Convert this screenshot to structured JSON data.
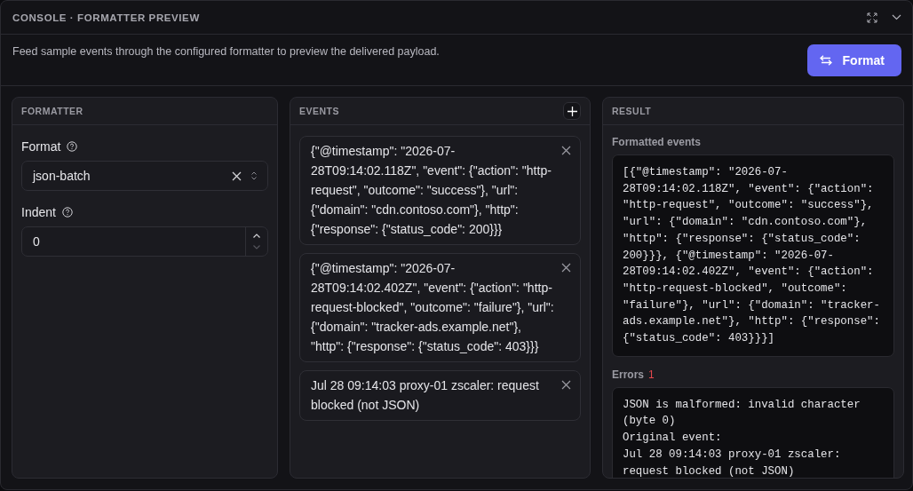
{
  "window": {
    "title": "CONSOLE · FORMATTER PREVIEW"
  },
  "description": "Feed sample events through the configured formatter to preview the delivered payload.",
  "format_button": {
    "label": "Format"
  },
  "formatter": {
    "title": "FORMATTER",
    "fields": [
      {
        "kind": "select",
        "label": "Format",
        "value": "json-batch"
      },
      {
        "kind": "number",
        "label": "Indent",
        "value": "0"
      }
    ]
  },
  "events": {
    "title": "EVENTS",
    "items": [
      {
        "text": "{\"@timestamp\": \"2026-07-28T09:14:02.118Z\", \"event\": {\"action\": \"http-request\", \"outcome\": \"success\"}, \"url\": {\"domain\": \"cdn.contoso.com\"}, \"http\": {\"response\": {\"status_code\": 200}}}"
      },
      {
        "text": "{\"@timestamp\": \"2026-07-28T09:14:02.402Z\", \"event\": {\"action\": \"http-request-blocked\", \"outcome\": \"failure\"}, \"url\": {\"domain\": \"tracker-ads.example.net\"}, \"http\": {\"response\": {\"status_code\": 403}}}"
      },
      {
        "text": "Jul 28 09:14:03 proxy-01 zscaler: request blocked (not JSON)"
      }
    ]
  },
  "result": {
    "title": "RESULT",
    "formatted_label": "Formatted events",
    "formatted": "[{\"@timestamp\": \"2026-07-28T09:14:02.118Z\", \"event\": {\"action\": \"http-request\", \"outcome\": \"success\"}, \"url\": {\"domain\": \"cdn.contoso.com\"}, \"http\": {\"response\": {\"status_code\": 200}}}, {\"@timestamp\": \"2026-07-28T09:14:02.402Z\", \"event\": {\"action\": \"http-request-blocked\", \"outcome\": \"failure\"}, \"url\": {\"domain\": \"tracker-ads.example.net\"}, \"http\": {\"response\": {\"status_code\": 403}}}]",
    "errors_label": "Errors",
    "errors_count": "1",
    "errors": "JSON is malformed: invalid character (byte 0)\nOriginal event:\nJul 28 09:14:03 proxy-01 zscaler: request blocked (not JSON)"
  }
}
